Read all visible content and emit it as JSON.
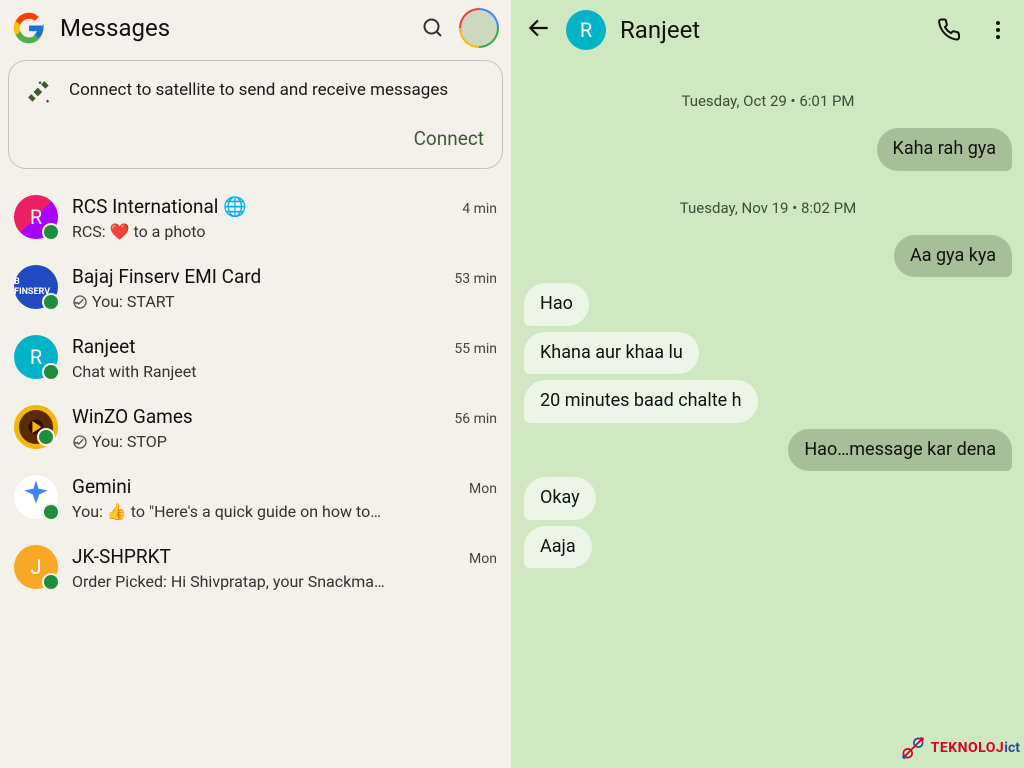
{
  "left": {
    "title": "Messages",
    "satellite": {
      "message": "Connect to satellite to send and receive messages",
      "button": "Connect"
    },
    "conversations": [
      {
        "name": "RCS International 🌐",
        "preview": "RCS: ❤️ to a photo",
        "time": "4 min",
        "avatar_letter": "R",
        "avatar_style": "rcs",
        "you_sent": false
      },
      {
        "name": "Bajaj Finserv EMI Card",
        "preview": "You: START",
        "time": "53 min",
        "avatar_letter": "B FINSERV",
        "avatar_style": "bajaj",
        "you_sent": true
      },
      {
        "name": "Ranjeet",
        "preview": "Chat with Ranjeet",
        "time": "55 min",
        "avatar_letter": "R",
        "avatar_style": "ranjeet",
        "you_sent": false
      },
      {
        "name": "WinZO Games",
        "preview": "You: STOP",
        "time": "56 min",
        "avatar_letter": "",
        "avatar_style": "winzo",
        "you_sent": true
      },
      {
        "name": "Gemini",
        "preview": "You: 👍 to \"Here's a quick guide on how to…",
        "time": "Mon",
        "avatar_letter": "",
        "avatar_style": "gemini",
        "you_sent": false
      },
      {
        "name": "JK-SHPRKT",
        "preview": "Order Picked: Hi Shivpratap, your Snackma…",
        "time": "Mon",
        "avatar_letter": "J",
        "avatar_style": "jk",
        "you_sent": false
      }
    ]
  },
  "right": {
    "contact_name": "Ranjeet",
    "contact_initial": "R",
    "messages": [
      {
        "type": "timestamp",
        "text": "Tuesday, Oct 29 • 6:01 PM"
      },
      {
        "type": "out",
        "text": "Kaha rah gya"
      },
      {
        "type": "timestamp",
        "text": "Tuesday, Nov 19 • 8:02 PM"
      },
      {
        "type": "out",
        "text": "Aa gya kya"
      },
      {
        "type": "in",
        "text": "Hao"
      },
      {
        "type": "in",
        "text": "Khana aur khaa lu"
      },
      {
        "type": "in",
        "text": "20 minutes baad chalte h"
      },
      {
        "type": "out",
        "text": "Hao…message kar dena"
      },
      {
        "type": "in",
        "text": "Okay"
      },
      {
        "type": "in",
        "text": "Aaja"
      }
    ]
  },
  "watermark": {
    "part1": "TEKNOLOJ",
    "part2": "ict"
  }
}
